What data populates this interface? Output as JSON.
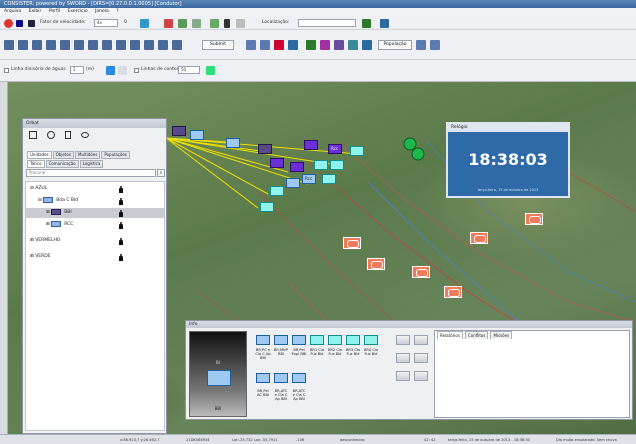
{
  "window": {
    "title": "CONSISTER, powered by SWORD - [DIRS=[0.27.0.0.1.0005] [Condutor]"
  },
  "menu": [
    "Arquivo",
    "Exibir",
    "Perfil",
    "Exercício",
    "Janela",
    "?"
  ],
  "toolbar1": {
    "speed_label": "Fator de velocidade:",
    "speed_value": "4x",
    "counter": "0",
    "localization_label": "Localização:",
    "localization_value": ""
  },
  "toolbar2": {
    "submit_label": "Submit",
    "population_label": "População"
  },
  "toolbar3": {
    "water_label": "Linha divisória de águas",
    "water_value": "2",
    "water_unit": "(m)",
    "contour_label": "Linhas de contorno",
    "contour_value": "50"
  },
  "orbat": {
    "title": "Orbat",
    "tabs": [
      "Unidades",
      "Objetos",
      "Multidões",
      "Populações"
    ],
    "subtabs": [
      "Tático",
      "Comunicação",
      "Logística"
    ],
    "search_placeholder": "Procurar",
    "tree": [
      {
        "label": "AZUL",
        "level": 0
      },
      {
        "label": "Bda C Bld",
        "level": 1
      },
      {
        "label": "BBI",
        "level": 2
      },
      {
        "label": "RCC",
        "level": 2
      },
      {
        "label": "VERMELHO",
        "level": 0
      },
      {
        "label": "VERDE",
        "level": 0
      }
    ]
  },
  "clock": {
    "title": "Relógio",
    "time": "18:38:03",
    "date": "terça-feira, 15 de outubro de 2013"
  },
  "map_labels": {
    "unit_a": "Rcc",
    "unit_b": "Rcc"
  },
  "info": {
    "title": "Info",
    "image_title": "BI",
    "image_caption": "BBI",
    "subordinates": [
      "BR,PC e Cia C Ap BBI",
      "BR,MtrP BBI",
      "BR,Pel Expl BBI",
      "BR1 Cia Fuz Bld",
      "BR2 Cia Fuz Bld",
      "BR3 Cia Fuz Bld",
      "BR4 Cia Fuz Bld",
      "BR,Pel AC BBI",
      "BR,ATC e Cia C Ap BBI",
      "BR,ATC e Cia C Ap BBI"
    ],
    "report_tabs": [
      "Relatórios",
      "Conflitos",
      "Missões"
    ]
  },
  "status": {
    "coords": "x:86.923,7 y:26.462,7",
    "mgrs": "21DKV86934",
    "latlon": "Lat:-25,732 Lon:-55,7911",
    "zoom": "-106",
    "state": "desconhecido",
    "tick": "42: 42",
    "datetime": "terça-feira, 15 de outubro de 2013 - 18:38:30",
    "weather": "Dia muito ensolarado. Sem chuva"
  }
}
